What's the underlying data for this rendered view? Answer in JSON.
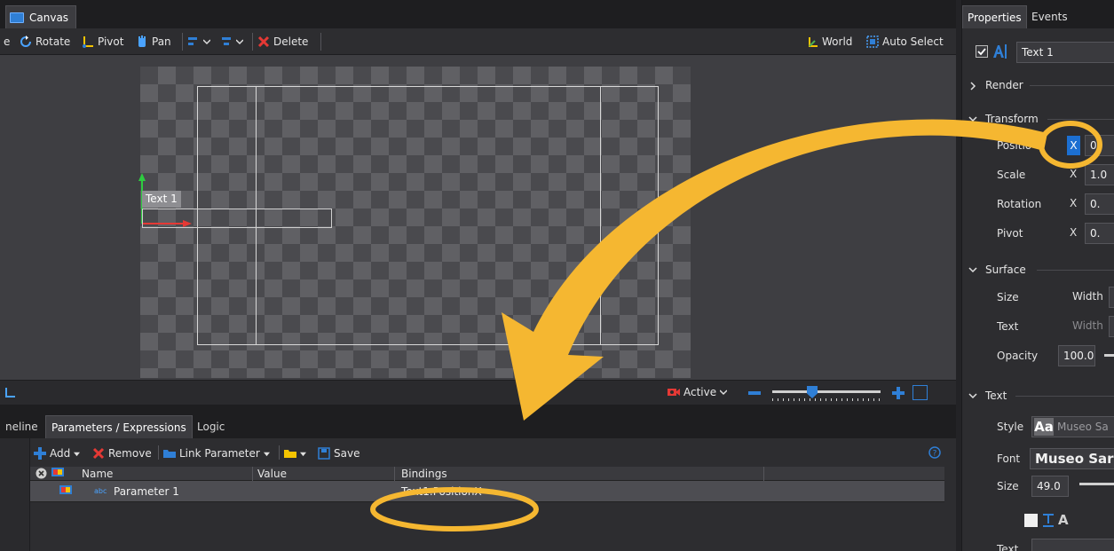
{
  "canvas": {
    "tab_label": "Canvas",
    "toolbar": {
      "truncated_left": "e",
      "rotate_label": "Rotate",
      "pivot_label": "Pivot",
      "pan_label": "Pan",
      "delete_label": "Delete",
      "world_label": "World",
      "auto_select_label": "Auto Select"
    },
    "viewport": {
      "text_layer_label": "Text 1"
    },
    "bottom_bar": {
      "active_label": "Active"
    }
  },
  "lower_panel": {
    "tabs": [
      {
        "label": "neline"
      },
      {
        "label": "Parameters / Expressions",
        "active": true
      },
      {
        "label": "Logic"
      }
    ],
    "toolbar": {
      "add_label": "Add",
      "remove_label": "Remove",
      "link_parameter_label": "Link Parameter",
      "save_label": "Save"
    },
    "grid": {
      "columns": [
        "Name",
        "Value",
        "Bindings"
      ],
      "rows": [
        {
          "type_badge": "abc",
          "name": "Parameter 1",
          "value": "",
          "bindings": "Text1.PositionX"
        }
      ]
    }
  },
  "properties": {
    "tabs": [
      {
        "label": "Properties",
        "active": true
      },
      {
        "label": "Events"
      }
    ],
    "object_name": "Text 1",
    "sections": {
      "render": "Render",
      "transform": "Transform",
      "surface": "Surface",
      "text": "Text"
    },
    "transform": {
      "position": {
        "label": "Positio",
        "axis": "X",
        "value": "0."
      },
      "scale": {
        "label": "Scale",
        "axis": "X",
        "value": "1.0"
      },
      "rotation": {
        "label": "Rotation",
        "axis": "X",
        "value": "0."
      },
      "pivot": {
        "label": "Pivot",
        "axis": "X",
        "value": "0."
      }
    },
    "surface": {
      "size": {
        "label": "Size",
        "sub": "Width"
      },
      "text": {
        "label": "Text",
        "sub": "Width"
      },
      "opacity": {
        "label": "Opacity",
        "value": "100.0"
      }
    },
    "text": {
      "style": {
        "label": "Style",
        "preview": "Aa",
        "value": "Museo Sa"
      },
      "font": {
        "label": "Font",
        "value": "Museo Sar"
      },
      "size": {
        "label": "Size",
        "value": "49.0"
      },
      "trailing_label": "Text"
    }
  },
  "colors": {
    "accent_blue": "#2f7fd6",
    "annotation_yellow": "#f5b731",
    "highlight_blue": "#1c6fd1"
  }
}
